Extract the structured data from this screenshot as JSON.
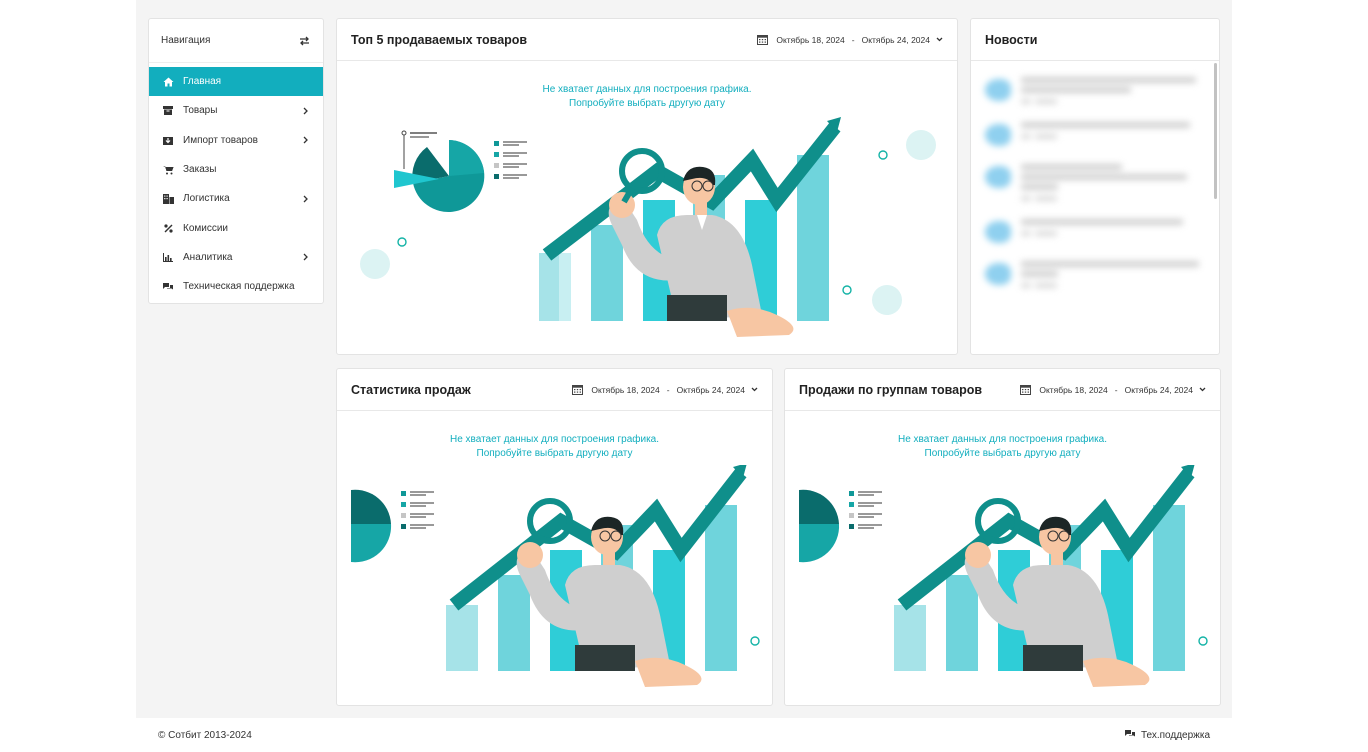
{
  "nav": {
    "title": "Навигация",
    "items": [
      {
        "label": "Главная",
        "icon": "home-icon",
        "active": true
      },
      {
        "label": "Товары",
        "icon": "box-icon",
        "has_children": true
      },
      {
        "label": "Импорт товаров",
        "icon": "import-icon",
        "has_children": true
      },
      {
        "label": "Заказы",
        "icon": "cart-icon"
      },
      {
        "label": "Логистика",
        "icon": "building-icon",
        "has_children": true
      },
      {
        "label": "Комиссии",
        "icon": "percent-icon"
      },
      {
        "label": "Аналитика",
        "icon": "bar-chart-icon",
        "has_children": true
      },
      {
        "label": "Техническая поддержка",
        "icon": "chat-icon"
      }
    ]
  },
  "widgets": {
    "top5": {
      "title": "Топ 5 продаваемых товаров",
      "date_from": "Октябрь 18, 2024",
      "date_sep": "-",
      "date_to": "Октябрь 24, 2024",
      "empty_line1": "Не хватает данных для построения графика.",
      "empty_line2": "Попробуйте выбрать другую дату"
    },
    "sales": {
      "title": "Статистика продаж",
      "date_from": "Октябрь 18, 2024",
      "date_sep": "-",
      "date_to": "Октябрь 24, 2024",
      "empty_line1": "Не хватает данных для построения графика.",
      "empty_line2": "Попробуйте выбрать другую дату"
    },
    "groups": {
      "title": "Продажи по группам товаров",
      "date_from": "Октябрь 18, 2024",
      "date_sep": "-",
      "date_to": "Октябрь 24, 2024",
      "empty_line1": "Не хватает данных для построения графика.",
      "empty_line2": "Попробуйте выбрать другую дату"
    }
  },
  "news": {
    "title": "Новости"
  },
  "footer": {
    "copyright": "© Сотбит 2013-2024",
    "support": "Тех.поддержка"
  },
  "colors": {
    "accent": "#12aebe",
    "teal_dark": "#0e8a8a",
    "teal_light": "#9fe3ea"
  }
}
